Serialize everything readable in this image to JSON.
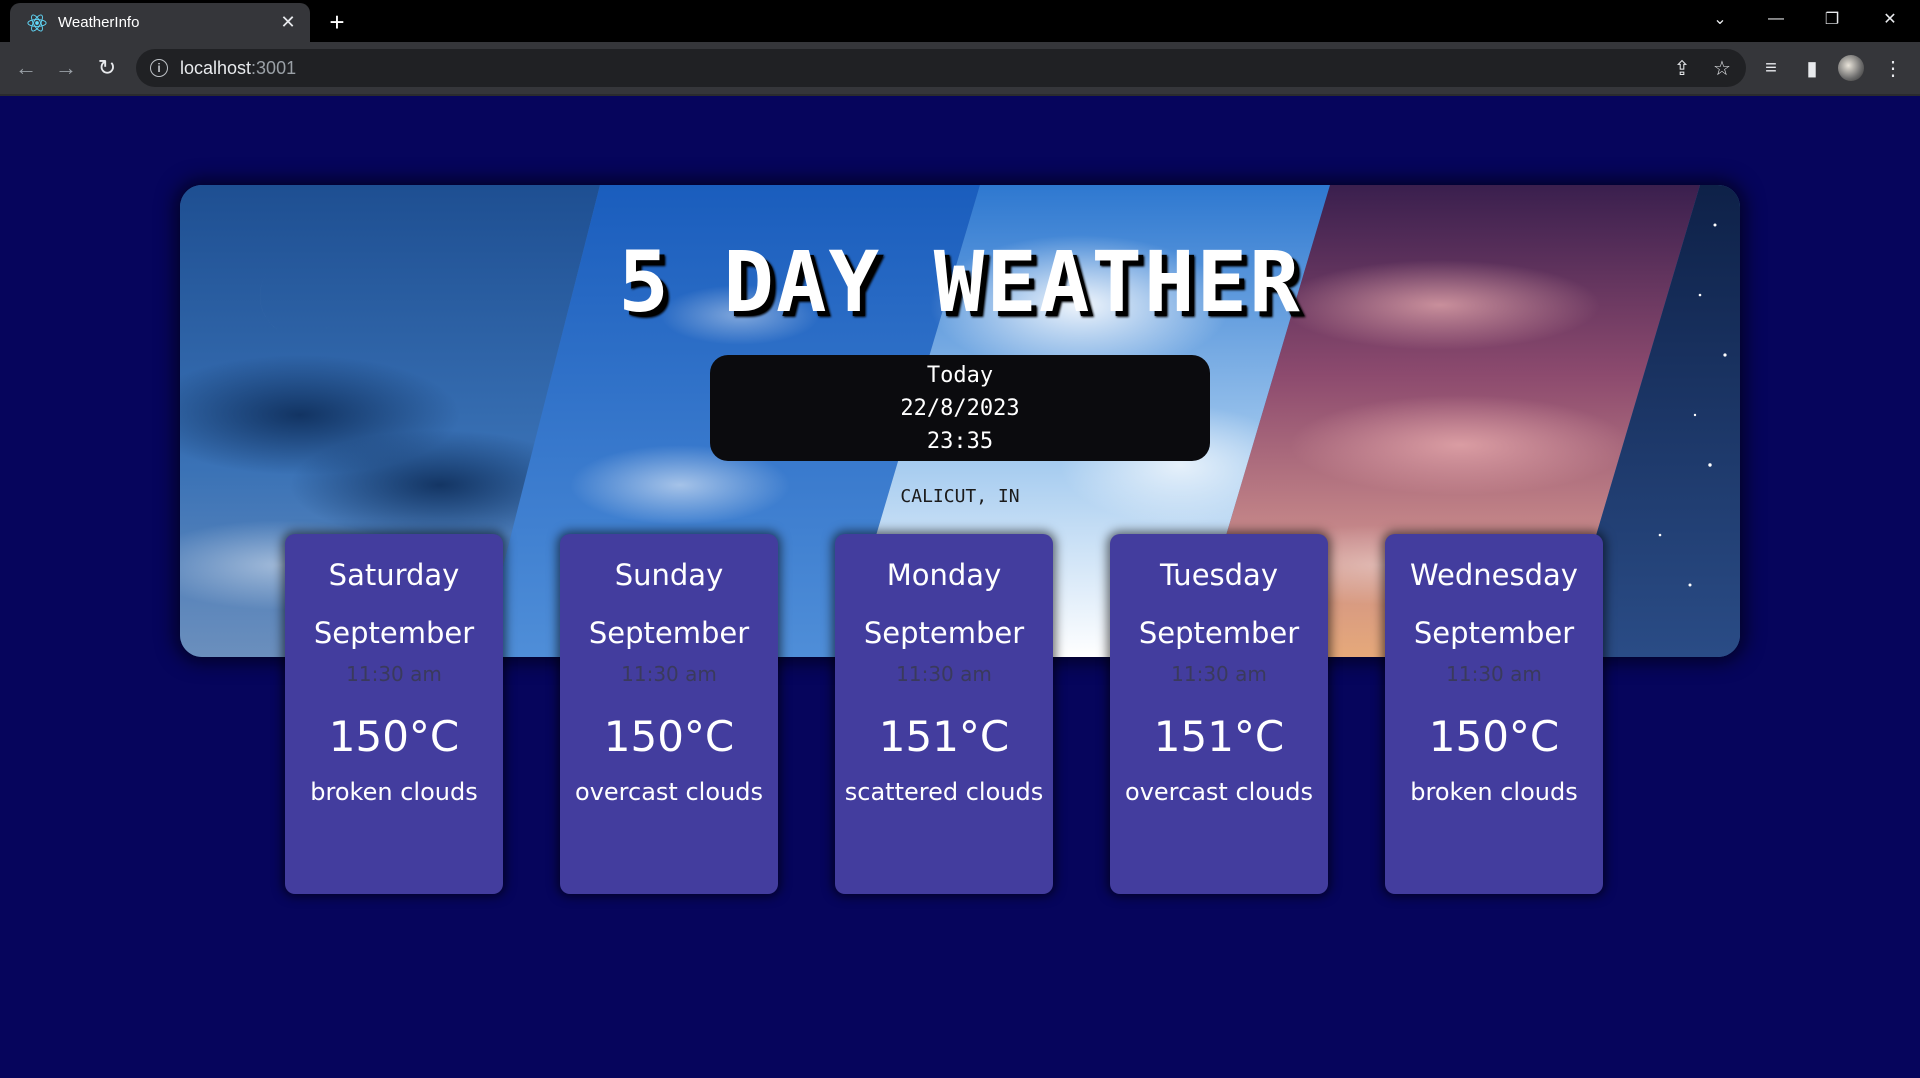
{
  "browser": {
    "tab_title": "WeatherInfo",
    "url_host": "localhost",
    "url_port": ":3001"
  },
  "page": {
    "title": "5 DAY WEATHER",
    "today_label": "Today",
    "date": "22/8/2023",
    "time": "23:35",
    "location": "CALICUT, IN"
  },
  "forecast": [
    {
      "day": "Saturday",
      "month": "September",
      "time": "11:30 am",
      "temp": "150°C",
      "desc": "broken clouds"
    },
    {
      "day": "Sunday",
      "month": "September",
      "time": "11:30 am",
      "temp": "150°C",
      "desc": "overcast clouds"
    },
    {
      "day": "Monday",
      "month": "September",
      "time": "11:30 am",
      "temp": "151°C",
      "desc": "scattered clouds"
    },
    {
      "day": "Tuesday",
      "month": "September",
      "time": "11:30 am",
      "temp": "151°C",
      "desc": "overcast clouds"
    },
    {
      "day": "Wednesday",
      "month": "September",
      "time": "11:30 am",
      "temp": "150°C",
      "desc": "broken clouds"
    }
  ],
  "icons": {
    "favicon": "react-atom-icon",
    "back": "back-arrow-icon",
    "forward": "forward-arrow-icon",
    "reload": "reload-icon",
    "info": "site-info-icon",
    "share": "share-icon",
    "bookmark": "star-icon",
    "media": "media-controls-icon",
    "sidepanel": "side-panel-icon",
    "menu": "kebab-menu-icon"
  },
  "colors": {
    "page_background": "#06055c",
    "card_background": "#433d9e",
    "today_box": "#0b0b0e"
  }
}
